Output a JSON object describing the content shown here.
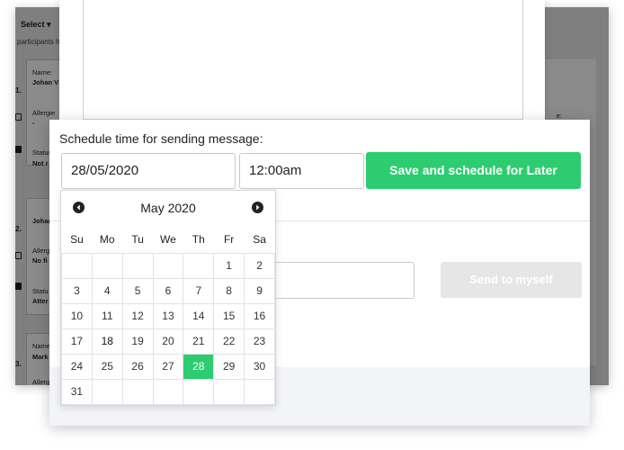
{
  "background": {
    "select_label": "Select ▾",
    "participants_text": "participants ha",
    "cards": [
      {
        "number": "1.",
        "name_label": "Name:",
        "name": "Johan V",
        "allergies_label": "Allergie",
        "allergies": "-",
        "status_label": "Status",
        "status": "Not r"
      },
      {
        "number": "2.",
        "name_label": "Name:",
        "name": "Johan",
        "allergies_label": "Allerg",
        "allergies": "No fi",
        "status_label": "Statu",
        "status": "Atter"
      },
      {
        "number": "3.",
        "name_label": "Name",
        "name": "Mark",
        "allergies_label": "Allerg",
        "allergies": "",
        "status_label": "",
        "status": ""
      }
    ],
    "right_label": "e:"
  },
  "schedule": {
    "title": "Schedule time for sending message:",
    "date_value": "28/05/2020",
    "time_value": "12:00am",
    "save_label": "Save and schedule for Later",
    "send_label": "Send to myself",
    "hidden_letter": "S"
  },
  "calendar": {
    "month_label": "May 2020",
    "weekdays": [
      "Su",
      "Mo",
      "Tu",
      "We",
      "Th",
      "Fr",
      "Sa"
    ],
    "weeks": [
      [
        "",
        "",
        "",
        "",
        "",
        "1",
        "2"
      ],
      [
        "3",
        "4",
        "5",
        "6",
        "7",
        "8",
        "9"
      ],
      [
        "10",
        "11",
        "12",
        "13",
        "14",
        "15",
        "16"
      ],
      [
        "17",
        "18",
        "19",
        "20",
        "21",
        "22",
        "23"
      ],
      [
        "24",
        "25",
        "26",
        "27",
        "28",
        "29",
        "30"
      ],
      [
        "31",
        "",
        "",
        "",
        "",
        "",
        ""
      ]
    ],
    "selected_day": "28",
    "today_day": "18",
    "accent_color": "#2ecc71"
  }
}
